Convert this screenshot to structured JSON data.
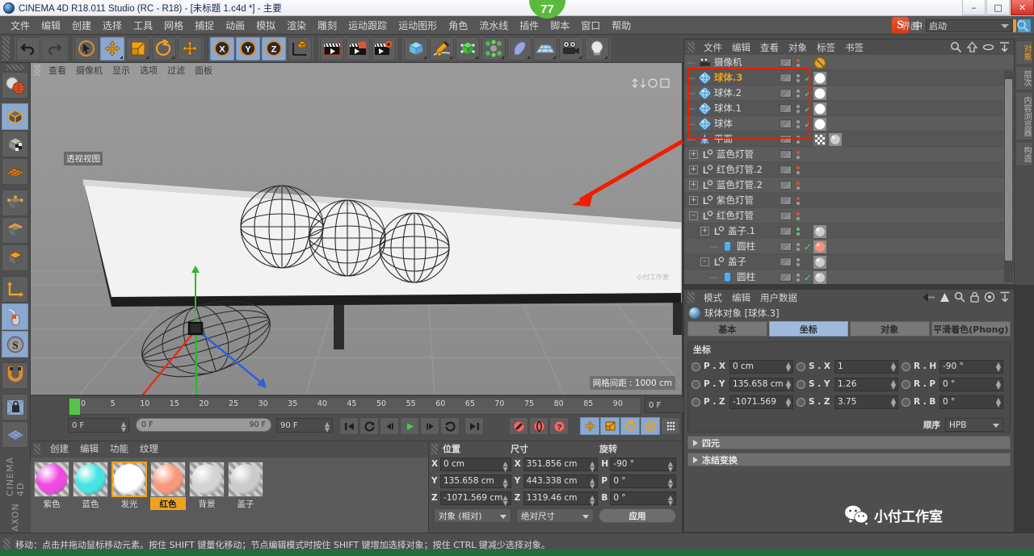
{
  "window": {
    "title": "CINEMA 4D R18.011 Studio (RC - R18) - [未标题 1.c4d *] - 主要",
    "minimize": "–",
    "maximize": "□",
    "close": "✕"
  },
  "menubar": {
    "items": [
      "文件",
      "编辑",
      "创建",
      "选择",
      "工具",
      "网格",
      "捕捉",
      "动画",
      "模拟",
      "渲染",
      "雕刻",
      "运动跟踪",
      "运动图形",
      "角色",
      "流水线",
      "插件",
      "脚本",
      "窗口",
      "帮助"
    ],
    "ime_text": "中",
    "badge": "77",
    "logo_letter": "S"
  },
  "toolbar": {
    "interface_label": "界面:",
    "interface_value": "启动",
    "icons": [
      "undo-icon",
      "redo-icon",
      "select-icon",
      "move-icon",
      "scale-icon",
      "rotate-icon",
      "move-world-icon",
      "axis-x-icon",
      "axis-y-icon",
      "axis-z-icon",
      "world-object-icon",
      "render-view-icon",
      "render-region-icon",
      "render-settings-icon",
      "cube-icon",
      "spline-pen-icon",
      "nurbs-icon",
      "array-icon",
      "bend-icon",
      "floor-icon",
      "camera-icon",
      "light-icon"
    ]
  },
  "left_palette": {
    "items": [
      "render-preview-icon",
      "model-mode-icon",
      "texture-mode-icon",
      "axis-mode-icon",
      "points-mode-icon",
      "edges-mode-icon",
      "polygons-mode-icon",
      "object-axis-icon",
      "enable-axis-icon",
      "soft-selection-icon",
      "magnet-icon",
      "workplane-lock-icon",
      "workplane-icon"
    ],
    "brand_top": "MAXON",
    "brand_bottom": "CINEMA 4D"
  },
  "viewport": {
    "menus": [
      "查看",
      "摄像机",
      "显示",
      "选项",
      "过滤",
      "面板"
    ],
    "view_label": "透视视图",
    "grid_label": "网格间距 : 1000 cm"
  },
  "timeline": {
    "ticks": [
      "0",
      "5",
      "10",
      "15",
      "20",
      "25",
      "30",
      "35",
      "40",
      "45",
      "50",
      "55",
      "60",
      "65",
      "70",
      "75",
      "80",
      "85",
      "90"
    ],
    "current_frame": "0 F",
    "start_field": "0 F",
    "range_start": "0 F",
    "range_end": "90 F",
    "end_field": "90 F",
    "buttons": [
      "go-to-start-icon",
      "prev-key-icon",
      "prev-frame-icon",
      "play-icon",
      "next-frame-icon",
      "next-key-icon",
      "go-to-end-icon",
      "record-icon",
      "autokey-icon",
      "keyframe-help-icon",
      "position-key-icon",
      "scale-key-icon",
      "rotation-key-icon",
      "param-key-icon",
      "point-level-key-icon",
      "timeline-icon"
    ]
  },
  "materials": {
    "menus": [
      "创建",
      "编辑",
      "功能",
      "纹理"
    ],
    "items": [
      {
        "name": "紫色",
        "color": "#ef4ae2",
        "selected": false,
        "label_highlight": false
      },
      {
        "name": "蓝色",
        "color": "#45e4e0",
        "selected": false,
        "label_highlight": false
      },
      {
        "name": "发光",
        "color": "#ffffff",
        "selected": true,
        "label_highlight": false
      },
      {
        "name": "红色",
        "color": "#f8997e",
        "selected": false,
        "label_highlight": true
      },
      {
        "name": "背景",
        "color": "#d4d4d4",
        "selected": false,
        "label_highlight": false
      },
      {
        "name": "盖子",
        "color": "#cbcbcb",
        "selected": false,
        "label_highlight": false
      }
    ]
  },
  "object_manager": {
    "menus": [
      "文件",
      "编辑",
      "查看",
      "对象",
      "标签",
      "书签"
    ],
    "header_icons": [
      "search-icon",
      "up-level-icon",
      "ellipse-icon",
      "fit-icon"
    ],
    "rows": [
      {
        "name": "摄像机",
        "icon": "camera-icon",
        "indent": 0,
        "expander": "none",
        "selected": false,
        "check": false,
        "dot": "#e34b3b",
        "tags": [
          "forbid"
        ]
      },
      {
        "name": "球体.3",
        "icon": "sphere-icon",
        "indent": 0,
        "expander": "none",
        "selected": true,
        "check": true,
        "dot": "#9c9c9c",
        "tags": [
          "mat-white"
        ]
      },
      {
        "name": "球体.2",
        "icon": "sphere-icon",
        "indent": 0,
        "expander": "none",
        "selected": false,
        "check": true,
        "dot": "#9c9c9c",
        "tags": [
          "mat-white"
        ]
      },
      {
        "name": "球体.1",
        "icon": "sphere-icon",
        "indent": 0,
        "expander": "none",
        "selected": false,
        "check": true,
        "dot": "#9c9c9c",
        "tags": [
          "mat-white"
        ]
      },
      {
        "name": "球体",
        "icon": "sphere-icon",
        "indent": 0,
        "expander": "none",
        "selected": false,
        "check": true,
        "dot": "#9c9c9c",
        "tags": [
          "mat-white"
        ]
      },
      {
        "name": "平面",
        "icon": "plane-icon",
        "indent": 0,
        "expander": "none",
        "selected": false,
        "check": false,
        "dot": "#9c9c9c",
        "tags": [
          "checker",
          "mat-gray"
        ]
      },
      {
        "name": "蓝色灯管",
        "icon": "null-icon",
        "indent": 0,
        "expander": "plus",
        "selected": false,
        "check": false,
        "dot": "#e34b3b",
        "tags": []
      },
      {
        "name": "红色灯管.2",
        "icon": "null-icon",
        "indent": 0,
        "expander": "plus",
        "selected": false,
        "check": false,
        "dot": "#e34b3b",
        "tags": []
      },
      {
        "name": "蓝色灯管.2",
        "icon": "null-icon",
        "indent": 0,
        "expander": "plus",
        "selected": false,
        "check": false,
        "dot": "#e34b3b",
        "tags": []
      },
      {
        "name": "紫色灯管",
        "icon": "null-icon",
        "indent": 0,
        "expander": "plus",
        "selected": false,
        "check": false,
        "dot": "#e34b3b",
        "tags": []
      },
      {
        "name": "红色灯管",
        "icon": "null-icon",
        "indent": 0,
        "expander": "minus",
        "selected": false,
        "check": false,
        "dot": "#e34b3b",
        "tags": []
      },
      {
        "name": "盖子.1",
        "icon": "null-icon",
        "indent": 1,
        "expander": "plus",
        "selected": false,
        "check": false,
        "dot": "#5ed36a",
        "tags": [
          "mat-gray"
        ]
      },
      {
        "name": "圆柱",
        "icon": "cylinder-icon",
        "indent": 2,
        "expander": "none",
        "selected": false,
        "check": true,
        "dot": "#9c9c9c",
        "tags": [
          "mat-red"
        ]
      },
      {
        "name": "盖子",
        "icon": "null-icon",
        "indent": 1,
        "expander": "minus",
        "selected": false,
        "check": false,
        "dot": "#9c9c9c",
        "tags": [
          "mat-gray"
        ]
      },
      {
        "name": "圆柱",
        "icon": "cylinder-icon",
        "indent": 2,
        "expander": "none",
        "selected": false,
        "check": true,
        "dot": "#9c9c9c",
        "tags": [
          "mat-gray"
        ]
      }
    ],
    "side_tabs": [
      "对象",
      "层次",
      "内容浏览器",
      "构造"
    ]
  },
  "attribute_manager": {
    "menus": [
      "模式",
      "编辑",
      "用户数据"
    ],
    "header_icons": [
      "back-arrow-icon",
      "up-arrow-icon",
      "search-icon",
      "lock-icon",
      "target-icon",
      "fit-icon"
    ],
    "object_title": "球体对象 [球体.3]",
    "tabs": [
      {
        "label": "基本",
        "active": false
      },
      {
        "label": "坐标",
        "active": true
      },
      {
        "label": "对象",
        "active": false
      },
      {
        "label": "平滑着色(Phong)",
        "active": false
      }
    ],
    "section_title": "坐标",
    "fields": [
      {
        "label": "P . X",
        "value": "0 cm"
      },
      {
        "label": "S . X",
        "value": "1"
      },
      {
        "label": "R . H",
        "value": "-90 °"
      },
      {
        "label": "P . Y",
        "value": "135.658 cm"
      },
      {
        "label": "S . Y",
        "value": "1.26"
      },
      {
        "label": "R . P",
        "value": "0 °"
      },
      {
        "label": "P . Z",
        "value": "-1071.569"
      },
      {
        "label": "S . Z",
        "value": "3.75"
      },
      {
        "label": "R . B",
        "value": "0 °"
      }
    ],
    "order_label": "顺序",
    "order_value": "HPB",
    "collapsed_sections": [
      "四元",
      "冻结变换"
    ]
  },
  "coordinates_manager": {
    "headers": [
      "位置",
      "尺寸",
      "旋转"
    ],
    "rows": [
      {
        "axis1": "X",
        "pos": "0 cm",
        "axis2": "X",
        "size": "351.856 cm",
        "axis3": "H",
        "rot": "-90 °"
      },
      {
        "axis1": "Y",
        "pos": "135.658 cm",
        "axis2": "Y",
        "size": "443.338 cm",
        "axis3": "P",
        "rot": "0 °"
      },
      {
        "axis1": "Z",
        "pos": "-1071.569 cm",
        "axis2": "Z",
        "size": "1319.46 cm",
        "axis3": "B",
        "rot": "0 °"
      }
    ],
    "mode_select": "对象 (相对)",
    "size_select": "绝对尺寸",
    "apply_button": "应用"
  },
  "status_bar": {
    "text": "移动：点击并拖动鼠标移动元素。按住 SHIFT 键量化移动；节点编辑模式时按住 SHIFT 键增加选择对象；按住 CTRL 键减少选择对象。"
  },
  "watermark": {
    "text": "小付工作室"
  },
  "annotation": {
    "arrow": "red-arrow-pointing-to-selection",
    "highlight_box": "red-rectangle-around-spheres"
  }
}
